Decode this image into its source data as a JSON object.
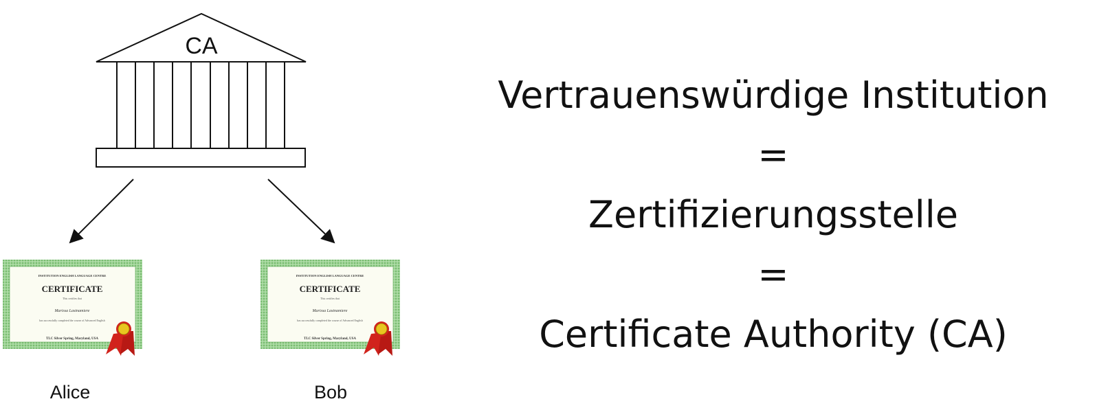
{
  "diagram": {
    "institution_label": "CA",
    "recipients": [
      {
        "name": "Alice",
        "certificate": {
          "header": "INSTITUTION ENGLISH LANGUAGE CENTRE",
          "title": "CERTIFICATE",
          "subtitle": "This certifies that",
          "holder": "Marissa Lastnamiere",
          "body": "has successfully completed the course of Advanced English",
          "footer": "TLC Silver Spring, Maryland, USA"
        }
      },
      {
        "name": "Bob",
        "certificate": {
          "header": "INSTITUTION ENGLISH LANGUAGE CENTRE",
          "title": "CERTIFICATE",
          "subtitle": "This certifies that",
          "holder": "Marissa Lastnamiere",
          "body": "has successfully completed the course of Advanced English",
          "footer": "TLC Silver Spring, Maryland, USA"
        }
      }
    ]
  },
  "definition": {
    "line1": "Vertrauenswürdige Institution",
    "eq1": "=",
    "line2": "Zertifizierungsstelle",
    "eq2": "=",
    "line3": "Certificate Authority (CA)"
  },
  "colors": {
    "certificate_border": "#86c47f",
    "certificate_paper": "#fbfcf2",
    "seal_gold": "#e8c620",
    "ribbon_red": "#d1231c"
  }
}
